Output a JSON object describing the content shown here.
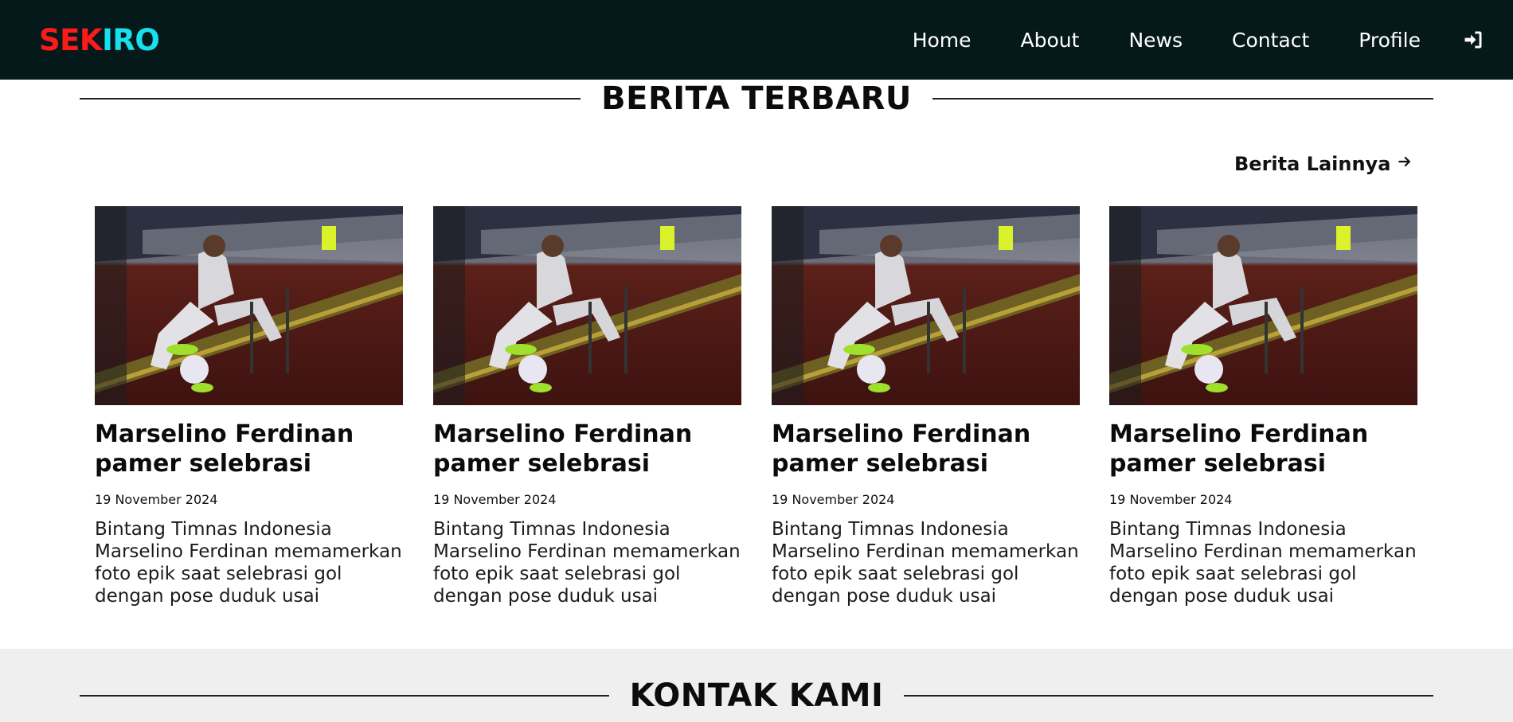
{
  "brand": {
    "part1": "SEK",
    "part2": "IRO",
    "color1": "#ff1a1a",
    "color2": "#18e0ec"
  },
  "nav": {
    "items": [
      {
        "label": "Home"
      },
      {
        "label": "About"
      },
      {
        "label": "News"
      },
      {
        "label": "Contact"
      },
      {
        "label": "Profile"
      }
    ],
    "login_icon": "sign-in-icon"
  },
  "news": {
    "heading": "BERITA TERBARU",
    "more_label": "Berita Lainnya",
    "more_icon": "arrow-right-icon",
    "cards": [
      {
        "title": "Marselino Ferdinan pamer selebrasi duduk..",
        "date": "19 November 2024",
        "excerpt": "Bintang Timnas Indonesia Marselino Ferdinan memamerkan foto epik saat selebrasi gol dengan pose duduk usai"
      },
      {
        "title": "Marselino Ferdinan pamer selebrasi duduk..",
        "date": "19 November 2024",
        "excerpt": "Bintang Timnas Indonesia Marselino Ferdinan memamerkan foto epik saat selebrasi gol dengan pose duduk usai"
      },
      {
        "title": "Marselino Ferdinan pamer selebrasi duduk..",
        "date": "19 November 2024",
        "excerpt": "Bintang Timnas Indonesia Marselino Ferdinan memamerkan foto epik saat selebrasi gol dengan pose duduk usai"
      },
      {
        "title": "Marselino Ferdinan pamer selebrasi duduk..",
        "date": "19 November 2024",
        "excerpt": "Bintang Timnas Indonesia Marselino Ferdinan memamerkan foto epik saat selebrasi gol dengan pose duduk usai"
      }
    ]
  },
  "contact": {
    "heading": "KONTAK KAMI"
  },
  "colors": {
    "navbar": "#05191b",
    "contact_bg": "#efefef",
    "text": "#111111"
  }
}
